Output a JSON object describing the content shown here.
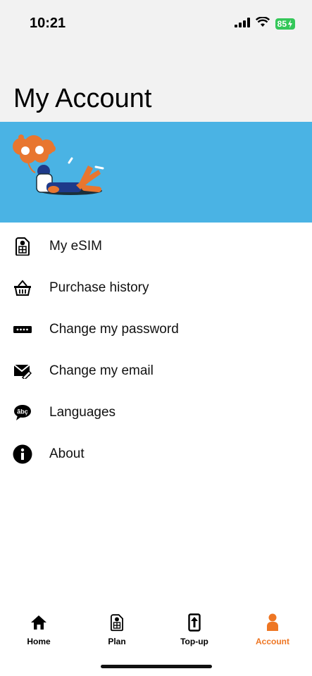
{
  "status_bar": {
    "time": "10:21",
    "battery": "85"
  },
  "page": {
    "title": "My Account"
  },
  "menu": [
    {
      "label": "My eSIM",
      "icon": "sim-card-icon"
    },
    {
      "label": "Purchase history",
      "icon": "basket-icon"
    },
    {
      "label": "Change my password",
      "icon": "password-icon"
    },
    {
      "label": "Change my email",
      "icon": "email-icon"
    },
    {
      "label": "Languages",
      "icon": "language-bubble-icon"
    },
    {
      "label": "About",
      "icon": "info-icon"
    }
  ],
  "tabbar": {
    "active_color": "#ee7623",
    "tabs": [
      {
        "label": "Home",
        "icon": "home-icon"
      },
      {
        "label": "Plan",
        "icon": "sim-card-icon"
      },
      {
        "label": "Top-up",
        "icon": "topup-phone-icon"
      },
      {
        "label": "Account",
        "icon": "person-icon",
        "active": true
      }
    ]
  },
  "colors": {
    "banner": "#4ab3e4",
    "accent": "#ee7623",
    "header_bg": "#f2f2f2"
  }
}
